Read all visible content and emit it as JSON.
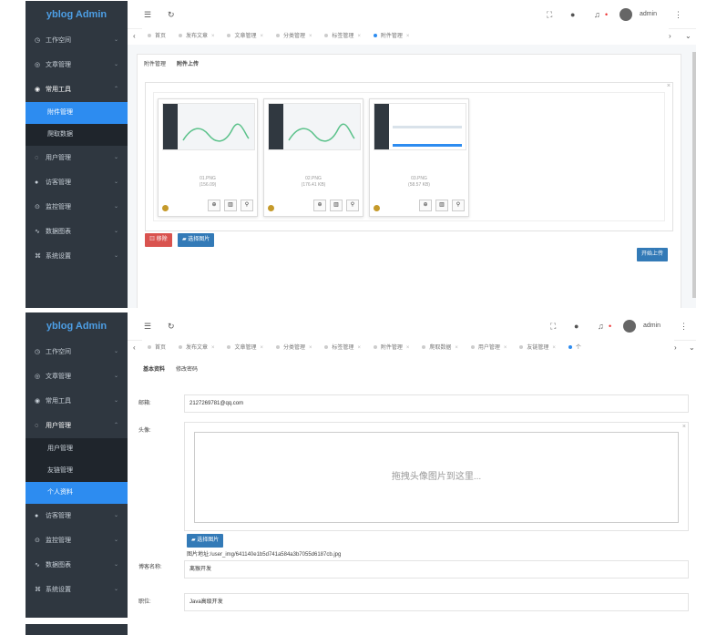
{
  "app": {
    "brand": "yblog Admin",
    "user": "admin"
  },
  "icons": {
    "menu": "☰",
    "refresh": "↻",
    "fullscreen": "⛶",
    "globe": "●",
    "bell": "♫",
    "more": "⋮",
    "left": "‹",
    "right": "›",
    "down": "⌄",
    "chev_down": "⌄",
    "chev_up": "⌃",
    "close": "×"
  },
  "screen1": {
    "menu": [
      {
        "icon": "◷",
        "label": "工作空间",
        "chev": "⌄"
      },
      {
        "icon": "◎",
        "label": "文章管理",
        "chev": "⌄"
      },
      {
        "icon": "◉",
        "label": "常用工具",
        "chev": "⌃"
      },
      {
        "icon": "◌",
        "label": "用户管理",
        "chev": "⌄"
      },
      {
        "icon": "●",
        "label": "访客管理",
        "chev": "⌄"
      },
      {
        "icon": "⊙",
        "label": "监控管理",
        "chev": "⌄"
      },
      {
        "icon": "∿",
        "label": "数据图表",
        "chev": "⌄"
      },
      {
        "icon": "⌘",
        "label": "系统设置",
        "chev": "⌄"
      }
    ],
    "submenu": [
      "附件管理",
      "爬取数据"
    ],
    "tabs": [
      "首页",
      "发布文章",
      "文章管理",
      "分类管理",
      "标签管理",
      "附件管理"
    ],
    "subtabs": [
      "附件管理",
      "附件上传"
    ],
    "files": [
      {
        "name": "01.PNG",
        "size": "(156.09)"
      },
      {
        "name": "02.PNG",
        "size": "(176.41 KB)"
      },
      {
        "name": "03.PNG",
        "size": "(58.57 KB)"
      }
    ],
    "file_btns": [
      "⊕",
      "▥",
      "⚲"
    ],
    "remove_label": "移除",
    "choose_label": "选择图片",
    "upload_label": "开始上传"
  },
  "screen2": {
    "menu_top": [
      {
        "icon": "◷",
        "label": "工作空间",
        "chev": "⌄"
      },
      {
        "icon": "◎",
        "label": "文章管理",
        "chev": "⌄"
      },
      {
        "icon": "◉",
        "label": "常用工具",
        "chev": "⌄"
      },
      {
        "icon": "◌",
        "label": "用户管理",
        "chev": "⌃"
      }
    ],
    "submenu": [
      "用户管理",
      "友链管理",
      "个人资料"
    ],
    "menu_bottom": [
      {
        "icon": "●",
        "label": "访客管理",
        "chev": "⌄"
      },
      {
        "icon": "⊙",
        "label": "监控管理",
        "chev": "⌄"
      },
      {
        "icon": "∿",
        "label": "数据图表",
        "chev": "⌄"
      },
      {
        "icon": "⌘",
        "label": "系统设置",
        "chev": "⌄"
      }
    ],
    "tabs": [
      "首页",
      "发布文章",
      "文章管理",
      "分类管理",
      "标签管理",
      "附件管理",
      "爬取数据",
      "用户管理",
      "友链管理",
      "个"
    ],
    "subtabs": [
      "基本资料",
      "修改密码"
    ],
    "email_label": "邮箱:",
    "email_value": "2127269781@qq.com",
    "avatar_label": "头像:",
    "drop_text": "拖拽头像图片到这里...",
    "choose_label": "选择图片",
    "url_text": "图片地址:/user_img/641140e1b5d741a584a3b7055d6187cb.jpg",
    "blog_label": "博客名称:",
    "blog_value": "离猴开发",
    "job_label": "职位:",
    "job_value": "Java高级开发"
  }
}
